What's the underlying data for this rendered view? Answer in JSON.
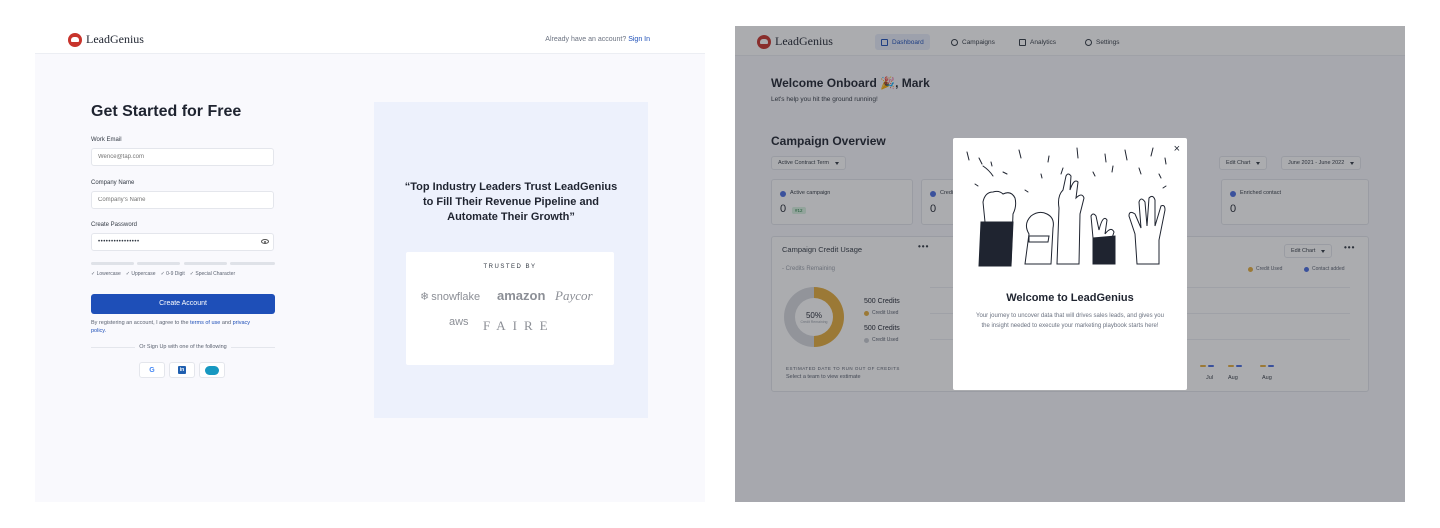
{
  "signup": {
    "brand": "LeadGenius",
    "account_prompt": "Already have an account?",
    "sign_in": "Sign In",
    "title": "Get Started for Free",
    "email_label": "Work Email",
    "email_placeholder": "Wence@tap.com",
    "company_label": "Company Name",
    "company_placeholder": "Company's Name",
    "password_label": "Create Password",
    "password_value": "••••••••••••••••",
    "rules": [
      "Lowercase",
      "Uppercase",
      "0-9 Digit",
      "Special Character"
    ],
    "create_button": "Create Account",
    "legal_prefix": "By registering an account, I agree to the",
    "terms": "terms of use",
    "legal_and": "and",
    "privacy": "privacy policy.",
    "or_signup": "Or Sign Up with one of the following",
    "social": {
      "google": "G",
      "linkedin": "in"
    },
    "quote": "“Top Industry Leaders Trust LeadGenius to Fill Their Revenue Pipeline and Automate Their Growth”",
    "trusted_by": "TRUSTED BY",
    "brands": {
      "snowflake": "snowflake",
      "amazon": "amazon",
      "paycor": "Paycor",
      "aws": "aws",
      "faire": "FAIRE"
    }
  },
  "dashboard": {
    "brand": "LeadGenius",
    "nav": [
      {
        "label": "Dashboard",
        "icon": "home-icon"
      },
      {
        "label": "Campaigns",
        "icon": "database-icon"
      },
      {
        "label": "Analytics",
        "icon": "chart-icon"
      },
      {
        "label": "Settings",
        "icon": "gear-icon"
      }
    ],
    "welcome_prefix": "Welcome Onboard",
    "welcome_emoji": "🎉",
    "welcome_name": ", Mark",
    "welcome_sub": "Let's help you hit the ground running!",
    "overview_title": "Campaign Overview",
    "term_filter": "Active Contract Term",
    "edit_chart": "Edit Chart",
    "date_range": "June 2021 - June 2022",
    "stats": [
      {
        "label": "Active campaign",
        "value": "0",
        "badge": "#12"
      },
      {
        "label": "Credi",
        "value": "0"
      },
      {
        "label": "Enriched contact",
        "value": "0"
      }
    ],
    "usage": {
      "title": "Campaign Credit Usage",
      "subtitle": "- Credits Remaining",
      "donut_percent": "50%",
      "donut_caption": "Credit Remaining",
      "credits_used_value": "500 Credits",
      "credits_used_label": "Credit Used",
      "credits_second_value": "500 Credits",
      "credits_second_label": "Credit Used",
      "estimate_title": "ESTIMATED DATE TO RUN OUT OF CREDITS",
      "estimate_sub": "Select a team to view estimate",
      "legend": [
        "Credit Used",
        "Contact added"
      ],
      "months": [
        "Jul",
        "Aug",
        "Aug"
      ]
    },
    "modal": {
      "title": "Welcome to LeadGenius",
      "body": "Your journey to uncover data that will drives sales leads, and gives you the insight needed to execute your marketing playbook starts here!",
      "close": "×"
    }
  },
  "colors": {
    "primary": "#1e4fb8",
    "brand_red": "#c8342c",
    "credit_used": "#e6ad3c",
    "contact_added": "#4a6de0"
  }
}
